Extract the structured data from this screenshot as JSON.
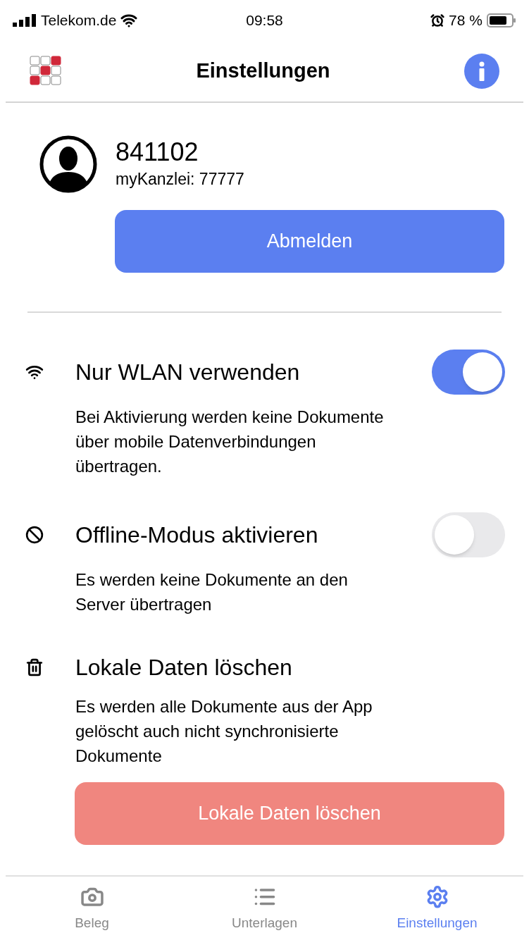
{
  "status_bar": {
    "carrier": "Telekom.de",
    "time": "09:58",
    "battery": "78 %"
  },
  "header": {
    "title": "Einstellungen"
  },
  "profile": {
    "user": "841102",
    "office": "myKanzlei: 77777",
    "button": "Abmelden"
  },
  "settings": [
    {
      "kind": "toggle",
      "title": "Nur WLAN verwenden",
      "description": "Bei Aktivierung werden keine Dokumente über mobile Datenverbindungen übertragen.",
      "on": true
    },
    {
      "kind": "toggle",
      "title": "Offline-Modus aktivieren",
      "description": "Es werden keine Dokumente an den Server übertragen",
      "on": false
    },
    {
      "kind": "action",
      "title": "Lokale Daten löschen",
      "description": "Es werden alle Dokumente aus der App gelöscht auch nicht synchronisierte Dokumente",
      "button": "Lokale Daten löschen"
    }
  ],
  "tabs": [
    {
      "label": "Beleg",
      "selected": false
    },
    {
      "label": "Unterlagen",
      "selected": false
    },
    {
      "label": "Einstellungen",
      "selected": true
    }
  ]
}
